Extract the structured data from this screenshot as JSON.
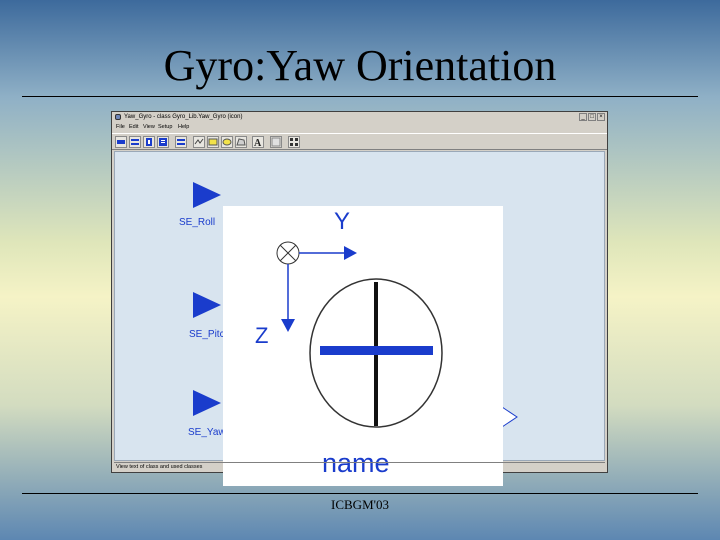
{
  "slide": {
    "title": "Gyro:Yaw Orientation",
    "footer": "ICBGM'03"
  },
  "window": {
    "title": "Yaw_Gyro - class Gyro_Lib.Yaw_Gyro (icon)",
    "buttons": {
      "minimize": "_",
      "maximize": "□",
      "close": "×"
    },
    "menu": [
      "File",
      "Edit",
      "View",
      "Setup",
      "Help"
    ],
    "status": "View text of class and used classes"
  },
  "toolbar": {
    "icons": [
      "diagram-icon",
      "layers-icon",
      "info-icon",
      "text-view-icon",
      "documentation-icon",
      "line-tool-icon",
      "rectangle-tool-icon",
      "ellipse-tool-icon",
      "polygon-tool-icon",
      "text-tool-icon",
      "bitmap-tool-icon",
      "connect-icon"
    ]
  },
  "diagram": {
    "ports": [
      {
        "label": "SE_Roll"
      },
      {
        "label": "SE_Pitch"
      },
      {
        "label": "SE_Yaw"
      }
    ],
    "axes": {
      "y": "Y",
      "z": "Z"
    },
    "component_name": "name",
    "colors": {
      "accent": "#1a3ccc",
      "canvas": "#d8e4ef",
      "block": "#ffffff"
    }
  }
}
